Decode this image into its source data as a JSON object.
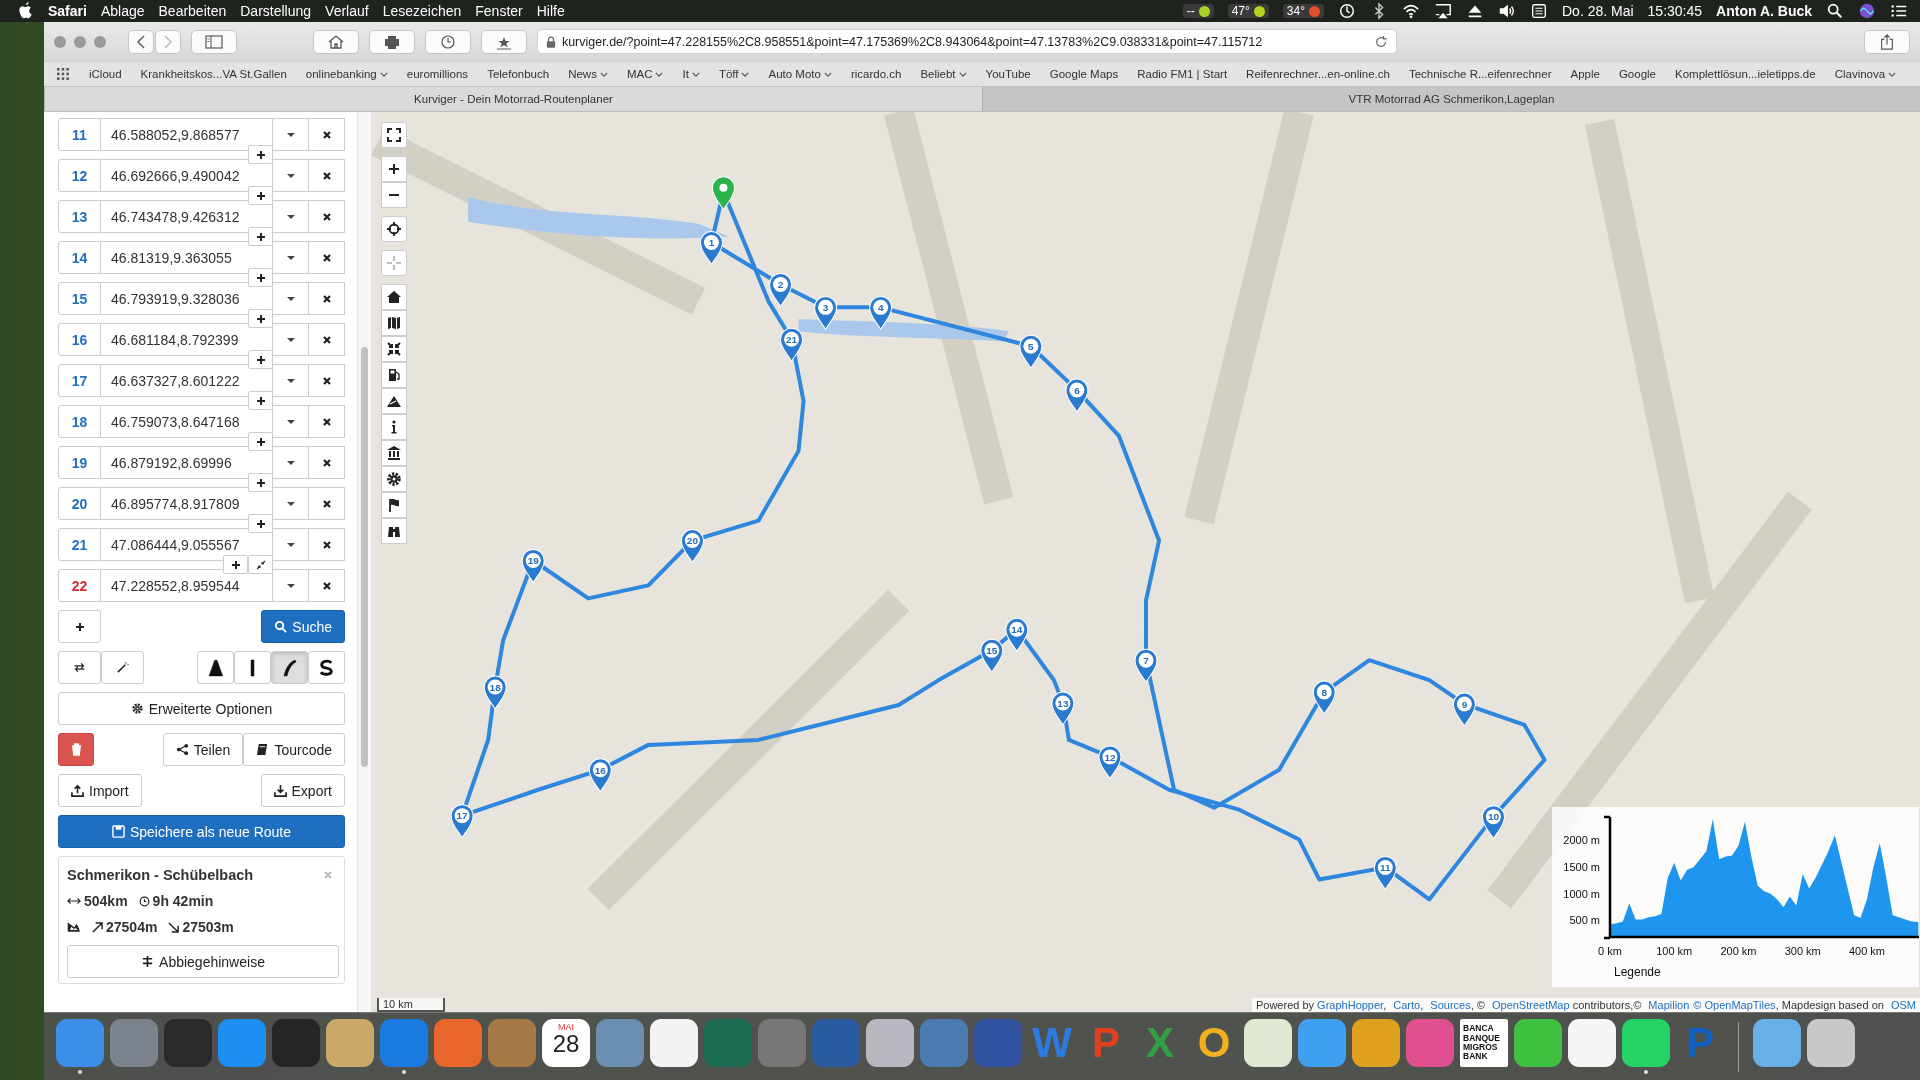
{
  "menubar": {
    "app": "Safari",
    "menus": [
      "Ablage",
      "Bearbeiten",
      "Darstellung",
      "Verlauf",
      "Lesezeichen",
      "Fenster",
      "Hilfe"
    ],
    "status": [
      {
        "label": "--",
        "color": "#a8d42a"
      },
      {
        "label": "47°",
        "color": "#b8d020"
      },
      {
        "label": "34°",
        "color": "#e0502a"
      }
    ],
    "date": "Do. 28. Mai",
    "time": "15:30:45",
    "user": "Anton A. Buck"
  },
  "browser": {
    "url": "kurviger.de/?point=47.228155%2C8.958551&point=47.175369%2C8.943064&point=47.13783%2C9.038331&point=47.115712",
    "bookmarks": [
      {
        "label": "iCloud",
        "menu": false
      },
      {
        "label": "Krankheitskos...VA St.Gallen",
        "menu": false
      },
      {
        "label": "onlinebanking",
        "menu": true
      },
      {
        "label": "euromillions",
        "menu": false
      },
      {
        "label": "Telefonbuch",
        "menu": false
      },
      {
        "label": "News",
        "menu": true
      },
      {
        "label": "MAC",
        "menu": true
      },
      {
        "label": "It",
        "menu": true
      },
      {
        "label": "Töff",
        "menu": true
      },
      {
        "label": "Auto Moto",
        "menu": true
      },
      {
        "label": "ricardo.ch",
        "menu": false
      },
      {
        "label": "Beliebt",
        "menu": true
      },
      {
        "label": "YouTube",
        "menu": false
      },
      {
        "label": "Google Maps",
        "menu": false
      },
      {
        "label": "Radio FM1 | Start",
        "menu": false
      },
      {
        "label": "Reifenrechner...en-online.ch",
        "menu": false
      },
      {
        "label": "Technische R...eifenrechner",
        "menu": false
      },
      {
        "label": "Apple",
        "menu": false
      },
      {
        "label": "Google",
        "menu": false
      },
      {
        "label": "Komplettlösun...ieletipps.de",
        "menu": false
      },
      {
        "label": "Clavinova",
        "menu": true
      }
    ],
    "tabs": [
      {
        "title": "Kurviger - Dein Motorrad-Routenplaner",
        "selected": true
      },
      {
        "title": "VTR Motorrad AG Schmerikon,Lageplan",
        "selected": false
      }
    ]
  },
  "sidebar": {
    "waypoints": [
      {
        "number": "11",
        "value": "46.588052,9.868577",
        "kind": "via"
      },
      {
        "number": "12",
        "value": "46.692666,9.490042",
        "kind": "via"
      },
      {
        "number": "13",
        "value": "46.743478,9.426312",
        "kind": "via"
      },
      {
        "number": "14",
        "value": "46.81319,9.363055",
        "kind": "via"
      },
      {
        "number": "15",
        "value": "46.793919,9.328036",
        "kind": "via"
      },
      {
        "number": "16",
        "value": "46.681184,8.792399",
        "kind": "via"
      },
      {
        "number": "17",
        "value": "46.637327,8.601222",
        "kind": "via"
      },
      {
        "number": "18",
        "value": "46.759073,8.647168",
        "kind": "via"
      },
      {
        "number": "19",
        "value": "46.879192,8.69996",
        "kind": "via"
      },
      {
        "number": "20",
        "value": "46.895774,8.917809",
        "kind": "via"
      },
      {
        "number": "21",
        "value": "47.086444,9.055567",
        "kind": "via"
      },
      {
        "number": "22",
        "value": "47.228552,8.959544",
        "kind": "end"
      }
    ],
    "search_button": "Suche",
    "route_modes": [
      {
        "kind": "fast",
        "selected": false
      },
      {
        "kind": "straight",
        "selected": false
      },
      {
        "kind": "curvy",
        "selected": true
      },
      {
        "kind": "extra-curvy",
        "selected": false
      }
    ],
    "advanced_options": "Erweiterte Optionen",
    "share": "Teilen",
    "tourcode": "Tourcode",
    "import": "Import",
    "export": "Export",
    "save": "Speichere als neue Route",
    "summary": {
      "title": "Schmerikon - Schübelbach",
      "distance": "504km",
      "duration": "9h 42min",
      "ascent": "27504m",
      "descent": "27503m",
      "directions": "Abbiegehinweise"
    }
  },
  "map": {
    "pins": [
      {
        "label": "1"
      },
      {
        "label": "2"
      },
      {
        "label": "3"
      },
      {
        "label": "4"
      },
      {
        "label": "5"
      },
      {
        "label": "6"
      },
      {
        "label": "7"
      },
      {
        "label": "8"
      },
      {
        "label": "9"
      },
      {
        "label": "10"
      },
      {
        "label": "11"
      },
      {
        "label": "12"
      },
      {
        "label": "13"
      },
      {
        "label": "14"
      },
      {
        "label": "15"
      },
      {
        "label": "16"
      },
      {
        "label": "17"
      },
      {
        "label": "18"
      },
      {
        "label": "19"
      },
      {
        "label": "20"
      },
      {
        "label": "21"
      }
    ],
    "scale": "10 km",
    "attribution": [
      {
        "text": "Powered by ",
        "kind": "text"
      },
      {
        "text": "GraphHopper",
        "kind": "link"
      },
      {
        "text": ", ",
        "kind": "text"
      },
      {
        "text": "Carto",
        "kind": "link"
      },
      {
        "text": ", ",
        "kind": "text"
      },
      {
        "text": "Sources",
        "kind": "link"
      },
      {
        "text": ", © ",
        "kind": "text"
      },
      {
        "text": "OpenStreetMap",
        "kind": "link"
      },
      {
        "text": " contributors,© ",
        "kind": "text"
      },
      {
        "text": "Mapilion",
        "kind": "link"
      },
      {
        "text": "© OpenMapTiles",
        "kind": "link"
      },
      {
        "text": ", Mapdesign based on ",
        "kind": "text"
      },
      {
        "text": "OSM",
        "kind": "link"
      }
    ],
    "elevation": {
      "legend": "Legende",
      "chart_data": {
        "type": "area",
        "xlim": [
          0,
          481
        ],
        "ylim": [
          190,
          2440
        ],
        "xticks": [
          {
            "value": 0,
            "label": "0 km"
          },
          {
            "value": 100,
            "label": "100 km"
          },
          {
            "value": 200,
            "label": "200 km"
          },
          {
            "value": 300,
            "label": "300 km"
          },
          {
            "value": 400,
            "label": "400 km"
          }
        ],
        "yticks": [
          {
            "value": 500,
            "label": "500 m"
          },
          {
            "value": 1000,
            "label": "1000 m"
          },
          {
            "value": 1500,
            "label": "1500 m"
          },
          {
            "value": 2000,
            "label": "2000 m"
          }
        ],
        "x": [
          0,
          10,
          20,
          30,
          40,
          50,
          60,
          70,
          80,
          90,
          100,
          110,
          120,
          130,
          140,
          150,
          160,
          170,
          180,
          190,
          200,
          210,
          220,
          230,
          240,
          250,
          260,
          270,
          280,
          290,
          300,
          310,
          320,
          330,
          340,
          350,
          360,
          370,
          380,
          390,
          400,
          410,
          420,
          430,
          440,
          450,
          460,
          470,
          480
        ],
        "series": [
          {
            "color": "#1e96f0",
            "values": [
              430,
              450,
              480,
              820,
              520,
              520,
              560,
              580,
              620,
              1300,
              1580,
              1250,
              1450,
              1500,
              1650,
              1800,
              2400,
              1650,
              1700,
              1720,
              1900,
              2350,
              1700,
              1150,
              1050,
              1000,
              900,
              750,
              950,
              780,
              1370,
              1100,
              1300,
              1550,
              1800,
              2100,
              1600,
              1100,
              600,
              550,
              900,
              1500,
              1950,
              1300,
              600,
              560,
              520,
              480,
              470
            ]
          }
        ]
      }
    }
  },
  "dock": [
    {
      "kind": "app",
      "color": "#3b8fe8",
      "running": true
    },
    {
      "kind": "app",
      "color": "#7d838d",
      "running": false
    },
    {
      "kind": "app",
      "color": "#2a2a2a",
      "running": false
    },
    {
      "kind": "app",
      "color": "#1f8ef1",
      "running": false
    },
    {
      "kind": "app",
      "color": "#262626",
      "running": false
    },
    {
      "kind": "app",
      "color": "#c9a868",
      "running": false
    },
    {
      "kind": "app",
      "color": "#1a7ae0",
      "running": true
    },
    {
      "kind": "app",
      "color": "#e8662a",
      "running": false
    },
    {
      "kind": "app",
      "color": "#a57a45",
      "running": false
    },
    {
      "kind": "calendar",
      "month": "MAI",
      "day": "28",
      "running": false
    },
    {
      "kind": "app",
      "color": "#6a8fb0",
      "running": false
    },
    {
      "kind": "app",
      "color": "#f3f3f3",
      "running": false
    },
    {
      "kind": "app",
      "color": "#1b6a52",
      "running": false
    },
    {
      "kind": "app",
      "color": "#777777",
      "running": false
    },
    {
      "kind": "app",
      "color": "#2a5aa0",
      "running": false
    },
    {
      "kind": "app",
      "color": "#b8b8c0",
      "running": false
    },
    {
      "kind": "app",
      "color": "#4a7ab0",
      "running": false
    },
    {
      "kind": "app",
      "color": "#3050a0",
      "running": false
    },
    {
      "kind": "letter",
      "glyph": "W",
      "color": "#2b7be0",
      "running": false
    },
    {
      "kind": "letter",
      "glyph": "P",
      "color": "#e04020",
      "running": false
    },
    {
      "kind": "letter",
      "glyph": "X",
      "color": "#30a040",
      "running": false
    },
    {
      "kind": "letter",
      "glyph": "O",
      "color": "#f0b020",
      "running": false
    },
    {
      "kind": "app",
      "color": "#dfe8d0",
      "running": false
    },
    {
      "kind": "app",
      "color": "#40a0f0",
      "running": false
    },
    {
      "kind": "app",
      "color": "#e0a020",
      "running": false
    },
    {
      "kind": "app",
      "color": "#e05090",
      "running": false
    },
    {
      "kind": "bank",
      "lines": [
        "BANCA",
        "BANQUE",
        "MIGROS",
        "BANK"
      ],
      "running": false
    },
    {
      "kind": "app",
      "color": "#40c040",
      "running": false
    },
    {
      "kind": "app",
      "color": "#f5f5f5",
      "running": false
    },
    {
      "kind": "app",
      "color": "#25d366",
      "running": true
    },
    {
      "kind": "letter",
      "glyph": "P",
      "color": "#1060c0",
      "running": false
    },
    {
      "kind": "separator"
    },
    {
      "kind": "app",
      "color": "#6ab0e8",
      "running": false
    },
    {
      "kind": "app",
      "color": "#c8c8c8",
      "running": false
    }
  ]
}
